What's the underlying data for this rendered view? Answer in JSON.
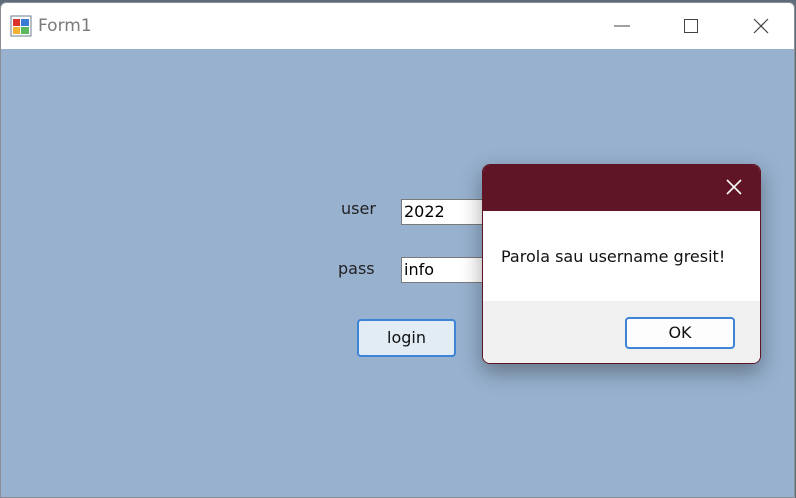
{
  "window": {
    "title": "Form1",
    "app_icon": "winforms-app-icon",
    "controls": [
      "minimize-icon",
      "maximize-icon",
      "close-icon"
    ]
  },
  "form": {
    "user_label": "user",
    "user_value": "2022",
    "pass_label": "pass",
    "pass_value": "info",
    "login_label": "login",
    "background_color": "#97b1ce"
  },
  "dialog": {
    "message": "Parola sau username gresit!",
    "ok_label": "OK",
    "accent_color": "#5f1526",
    "close_icon": "close-icon"
  }
}
